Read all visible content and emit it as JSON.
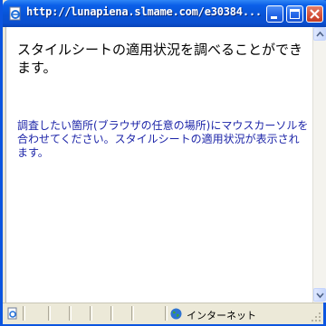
{
  "window": {
    "title": "http://lunapiena.slmame.com/e30384...",
    "controls": {
      "minimize": "minimize",
      "maximize": "maximize",
      "close": "close"
    }
  },
  "content": {
    "heading": "スタイルシートの適用状況を調べることができます。",
    "body": "調査したい箇所(ブラウザの任意の場所)にマウスカーソルを合わせてください。スタイルシートの適用状況が表示されます。"
  },
  "statusbar": {
    "zone_label": "インターネット",
    "zone_icon": "globe-icon",
    "page_icon": "page-icon"
  },
  "colors": {
    "titlebar": "#0853d6",
    "body_text": "#1c24a8",
    "close_button": "#d4513a"
  }
}
